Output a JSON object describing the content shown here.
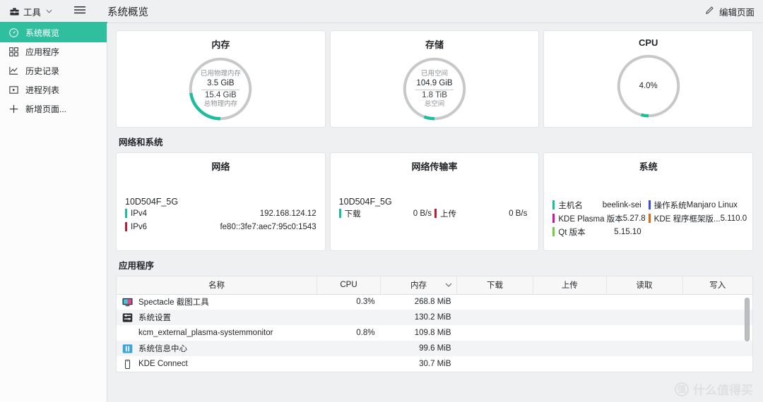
{
  "topbar": {
    "tools_label": "工具",
    "tools_icon": "toolbox-icon",
    "chevron": "˅",
    "hamburger_icon": "hamburger-menu-icon",
    "page_title": "系统概览",
    "edit_icon": "pencil-icon",
    "edit_label": "编辑页面"
  },
  "sidebar": {
    "items": [
      {
        "label": "系统概览",
        "icon": "gauge-icon",
        "selected": true
      },
      {
        "label": "应用程序",
        "icon": "grid-apps-icon",
        "selected": false
      },
      {
        "label": "历史记录",
        "icon": "line-chart-icon",
        "selected": false
      },
      {
        "label": "进程列表",
        "icon": "process-list-icon",
        "selected": false
      },
      {
        "label": "新增页面...",
        "icon": "plus-icon",
        "selected": false
      }
    ]
  },
  "gauges": [
    {
      "title": "内存",
      "top_label": "已用物理内存",
      "used": "3.5 GiB",
      "total": "15.4 GiB",
      "bottom_label": "总物理内存",
      "percent": 22.7,
      "center_percent": null
    },
    {
      "title": "存储",
      "top_label": "已用空间",
      "used": "104.9 GiB",
      "total": "1.8 TiB",
      "bottom_label": "总空间",
      "percent": 5.6,
      "center_percent": null
    },
    {
      "title": "CPU",
      "top_label": null,
      "used": null,
      "total": null,
      "bottom_label": null,
      "percent": 4.0,
      "center_percent": "4.0%"
    }
  ],
  "network_section": {
    "heading": "网络和系统",
    "network": {
      "title": "网络",
      "ssid": "10D504F_5G",
      "rows": [
        {
          "key": "IPv4",
          "value": "192.168.124.12",
          "color": "#1bbd9a"
        },
        {
          "key": "IPv6",
          "value": "fe80::3fe7:aec7:95c0:1543",
          "color": "#cc1533"
        }
      ]
    },
    "transfer": {
      "title": "网络传输率",
      "ssid": "10D504F_5G",
      "download": {
        "key": "下载",
        "value": "0 B/s",
        "color": "#1bbd9a"
      },
      "upload": {
        "key": "上传",
        "value": "0 B/s",
        "color": "#cc1533"
      }
    },
    "system": {
      "title": "系统",
      "left": [
        {
          "key": "主机名",
          "value": "beelink-sei",
          "color": "#1bbd9a"
        },
        {
          "key": "KDE Plasma 版本",
          "value": "5.27.8",
          "color": "#c9189f"
        },
        {
          "key": "Qt 版本",
          "value": "5.15.10",
          "color": "#6fcf3f"
        }
      ],
      "right": [
        {
          "key": "操作系统",
          "value": "Manjaro Linux",
          "color": "#3b4bd8"
        },
        {
          "key": "KDE 程序框架版...",
          "value": "5.110.0",
          "color": "#d8681b"
        }
      ]
    }
  },
  "apps_section": {
    "heading": "应用程序",
    "columns": [
      {
        "label": "名称",
        "sorted": false
      },
      {
        "label": "CPU",
        "sorted": false
      },
      {
        "label": "内存",
        "sorted": true
      },
      {
        "label": "下载",
        "sorted": false
      },
      {
        "label": "上传",
        "sorted": false
      },
      {
        "label": "读取",
        "sorted": false
      },
      {
        "label": "写入",
        "sorted": false
      }
    ],
    "sort_chevron": "˅",
    "rows": [
      {
        "name": "Spectacle 截图工具",
        "icon": "spectacle-app-icon",
        "icon_color": "#2f77c9",
        "cpu": "0.3%",
        "memory": "268.8 MiB",
        "download": "",
        "upload": "",
        "read": "",
        "write": ""
      },
      {
        "name": "系统设置",
        "icon": "system-settings-app-icon",
        "icon_color": "#2b2f33",
        "cpu": "",
        "memory": "130.2 MiB",
        "download": "",
        "upload": "",
        "read": "",
        "write": ""
      },
      {
        "name": "kcm_external_plasma-systemmonitor",
        "icon": null,
        "icon_color": null,
        "cpu": "0.8%",
        "memory": "109.8 MiB",
        "download": "",
        "upload": "",
        "read": "",
        "write": ""
      },
      {
        "name": "系统信息中心",
        "icon": "info-center-app-icon",
        "icon_color": "#2f8fd8",
        "cpu": "",
        "memory": "99.6 MiB",
        "download": "",
        "upload": "",
        "read": "",
        "write": ""
      },
      {
        "name": "KDE Connect",
        "icon": "kde-connect-app-icon",
        "icon_color": "#3f4347",
        "cpu": "",
        "memory": "30.7 MiB",
        "download": "",
        "upload": "",
        "read": "",
        "write": ""
      }
    ]
  },
  "watermark": {
    "mark": "值",
    "text": "什么值得买"
  },
  "colors": {
    "accent": "#2fbf9f",
    "gauge_track": "#c6c8ca",
    "window_bg": "#eff0f1",
    "card_bg": "#ffffff"
  }
}
